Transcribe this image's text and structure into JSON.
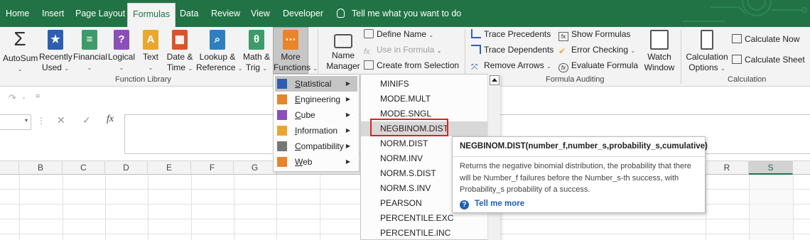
{
  "tabs": [
    "Home",
    "Insert",
    "Page Layout",
    "Formulas",
    "Data",
    "Review",
    "View",
    "Developer"
  ],
  "active_tab": "Formulas",
  "tell_me": "Tell me what you want to do",
  "ribbon": {
    "function_library": {
      "autosum": "AutoSum",
      "recently_used_1": "Recently",
      "recently_used_2": "Used",
      "financial": "Financial",
      "logical": "Logical",
      "text": "Text",
      "date_time_1": "Date &",
      "date_time_2": "Time",
      "lookup_1": "Lookup &",
      "lookup_2": "Reference",
      "math_1": "Math &",
      "math_2": "Trig",
      "more_1": "More",
      "more_2": "Functions",
      "group_label": "Function Library"
    },
    "defined_names": {
      "name_manager_1": "Name",
      "name_manager_2": "Manager",
      "define_name": "Define Name",
      "use_in_formula": "Use in Formula",
      "create_from_selection": "Create from Selection"
    },
    "formula_auditing": {
      "trace_precedents": "Trace Precedents",
      "trace_dependents": "Trace Dependents",
      "remove_arrows": "Remove Arrows",
      "show_formulas": "Show Formulas",
      "error_checking": "Error Checking",
      "evaluate_formula": "Evaluate Formula",
      "watch_window_1": "Watch",
      "watch_window_2": "Window",
      "group_label": "Formula Auditing"
    },
    "calculation": {
      "options_1": "Calculation",
      "options_2": "Options",
      "calculate_now": "Calculate Now",
      "calculate_sheet": "Calculate Sheet",
      "group_label": "Calculation"
    }
  },
  "formula_bar": {
    "fx": "fx",
    "cancel": "✕",
    "enter": "✓"
  },
  "columns": [
    "B",
    "C",
    "D",
    "E",
    "F",
    "G",
    "R",
    "S"
  ],
  "selected_column": "S",
  "more_functions_menu": [
    {
      "label": "Statistical",
      "icon": "statistical-icon"
    },
    {
      "label": "Engineering",
      "icon": "engineering-icon"
    },
    {
      "label": "Cube",
      "icon": "cube-icon"
    },
    {
      "label": "Information",
      "icon": "information-icon"
    },
    {
      "label": "Compatibility",
      "icon": "compatibility-icon"
    },
    {
      "label": "Web",
      "icon": "web-icon"
    }
  ],
  "highlighted_category": "Statistical",
  "statistical_functions": [
    "MINIFS",
    "MODE.MULT",
    "MODE.SNGL",
    "NEGBINOM.DIST",
    "NORM.DIST",
    "NORM.INV",
    "NORM.S.DIST",
    "NORM.S.INV",
    "PEARSON",
    "PERCENTILE.EXC",
    "PERCENTILE.INC"
  ],
  "highlighted_function": "NEGBINOM.DIST",
  "tooltip": {
    "title": "NEGBINOM.DIST(number_f,number_s,probability_s,cumulative)",
    "body": "Returns the negative binomial distribution, the probability that there will be Number_f failures before the Number_s-th success, with Probability_s probability of a success.",
    "link": "Tell me more"
  },
  "colors": {
    "brand_green": "#217346",
    "highlight_red": "#e02020",
    "link_blue": "#1f5fb0"
  }
}
